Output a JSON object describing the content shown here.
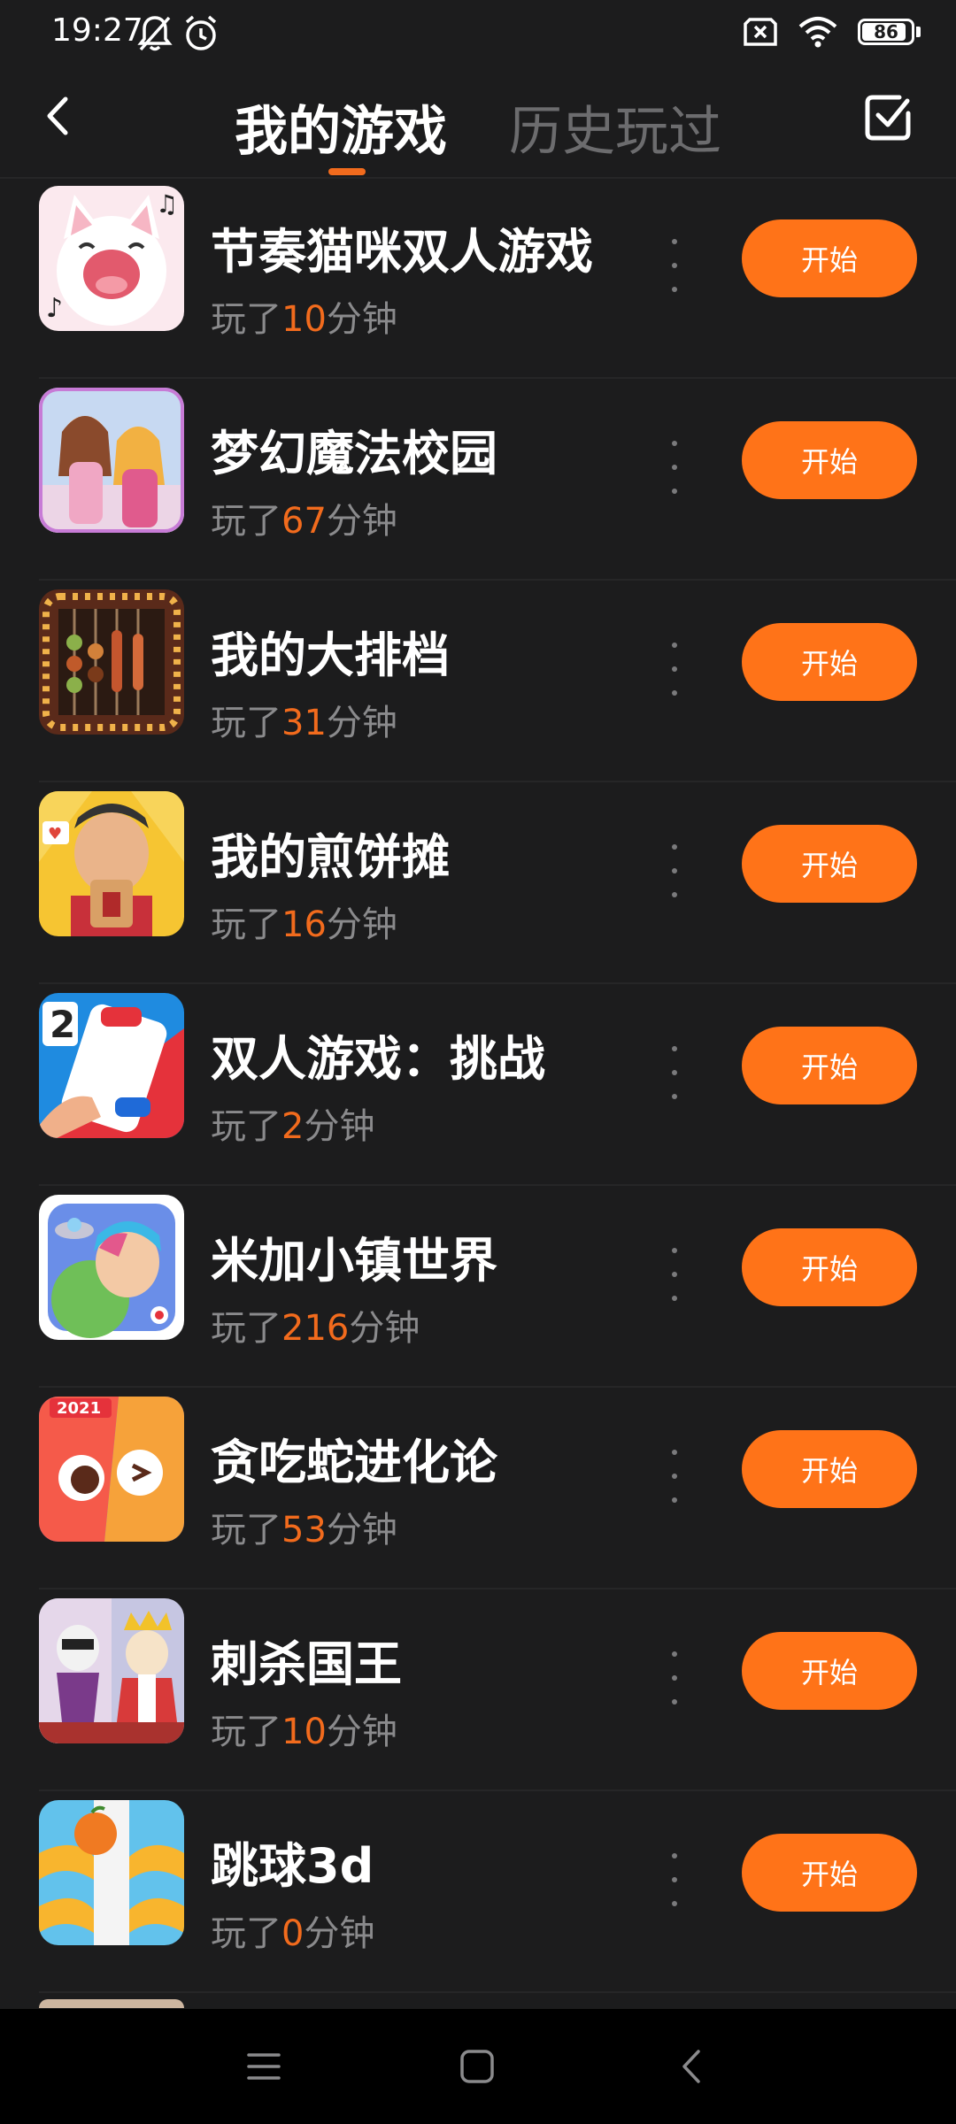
{
  "status_bar": {
    "time": "19:27",
    "battery": "86",
    "icons": [
      "bell-off-icon",
      "alarm-icon",
      "sim-off-icon",
      "wifi-icon",
      "battery-icon"
    ]
  },
  "header": {
    "tabs": [
      {
        "label": "我的游戏",
        "active": true
      },
      {
        "label": "历史玩过",
        "active": false
      }
    ],
    "accent": "#f26b1d"
  },
  "games": [
    {
      "name": "节奏猫咪双人游戏",
      "played_prefix": "玩了",
      "minutes": "10",
      "played_suffix": "分钟",
      "button": "开始"
    },
    {
      "name": "梦幻魔法校园",
      "played_prefix": "玩了",
      "minutes": "67",
      "played_suffix": "分钟",
      "button": "开始"
    },
    {
      "name": "我的大排档",
      "played_prefix": "玩了",
      "minutes": "31",
      "played_suffix": "分钟",
      "button": "开始"
    },
    {
      "name": "我的煎饼摊",
      "played_prefix": "玩了",
      "minutes": "16",
      "played_suffix": "分钟",
      "button": "开始"
    },
    {
      "name": "双人游戏：挑战",
      "played_prefix": "玩了",
      "minutes": "2",
      "played_suffix": "分钟",
      "button": "开始"
    },
    {
      "name": "米加小镇世界",
      "played_prefix": "玩了",
      "minutes": "216",
      "played_suffix": "分钟",
      "button": "开始"
    },
    {
      "name": "贪吃蛇进化论",
      "played_prefix": "玩了",
      "minutes": "53",
      "played_suffix": "分钟",
      "button": "开始",
      "badge": "2021"
    },
    {
      "name": "刺杀国王",
      "played_prefix": "玩了",
      "minutes": "10",
      "played_suffix": "分钟",
      "button": "开始"
    },
    {
      "name": "跳球3d",
      "played_prefix": "玩了",
      "minutes": "0",
      "played_suffix": "分钟",
      "button": "开始"
    }
  ],
  "nav": {
    "icons": [
      "menu-icon",
      "home-icon",
      "back-icon"
    ]
  },
  "colors": {
    "background": "#1c1c1d",
    "accent": "#ff7318",
    "muted_text": "#8a8a8c"
  }
}
